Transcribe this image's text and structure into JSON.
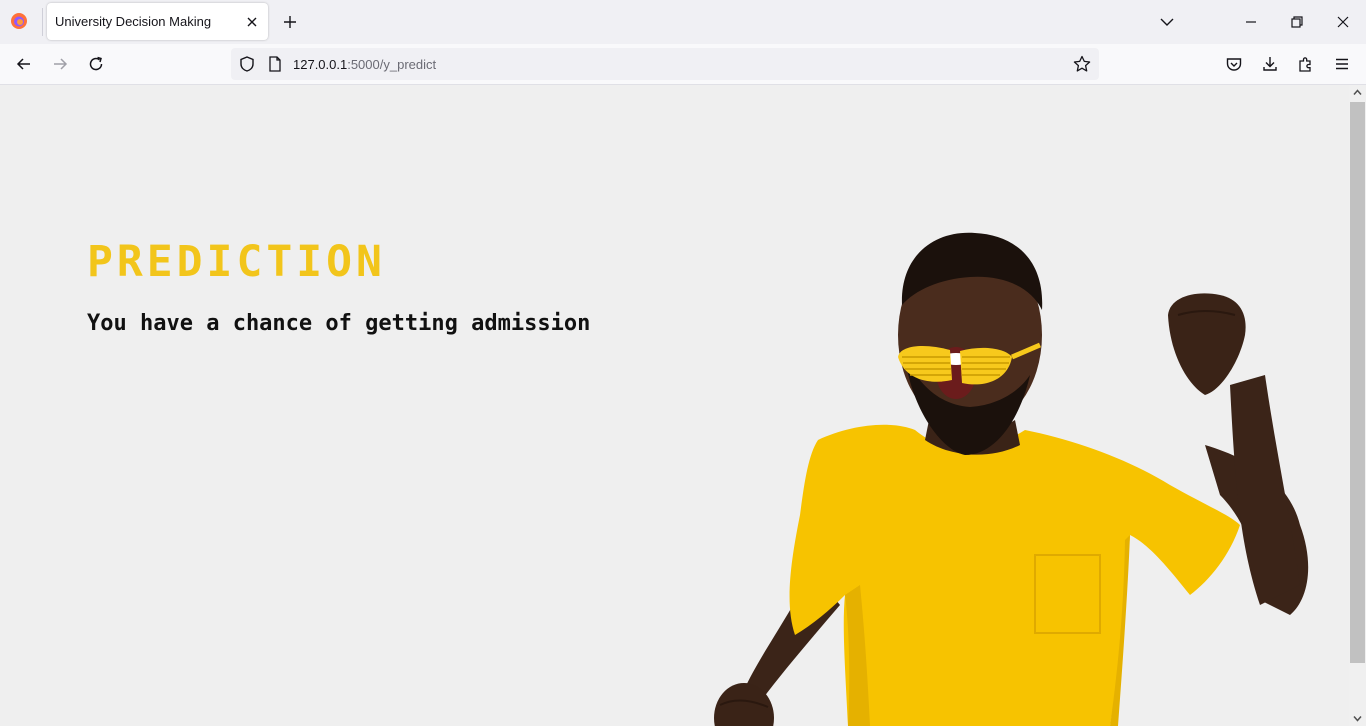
{
  "browser": {
    "tab_title": "University Decision Making",
    "url_host": "127.0.0.1",
    "url_path": ":5000/y_predict"
  },
  "page": {
    "heading": "PREDICTION",
    "result_text": "You have a chance of getting admission"
  },
  "icons": {
    "browser_logo": "firefox-icon",
    "tab_close": "close-icon",
    "new_tab": "plus-icon",
    "list_tabs": "chevron-down-icon",
    "back": "arrow-left-icon",
    "forward": "arrow-right-icon",
    "reload": "reload-icon",
    "tracking": "shield-icon",
    "page_info": "page-icon",
    "bookmark": "star-icon",
    "pocket": "pocket-icon",
    "downloads": "download-icon",
    "extensions": "puzzle-icon",
    "menu": "hamburger-icon"
  },
  "colors": {
    "heading": "#f2c51b",
    "page_background": "#efefef",
    "shirt": "#f7c300"
  }
}
